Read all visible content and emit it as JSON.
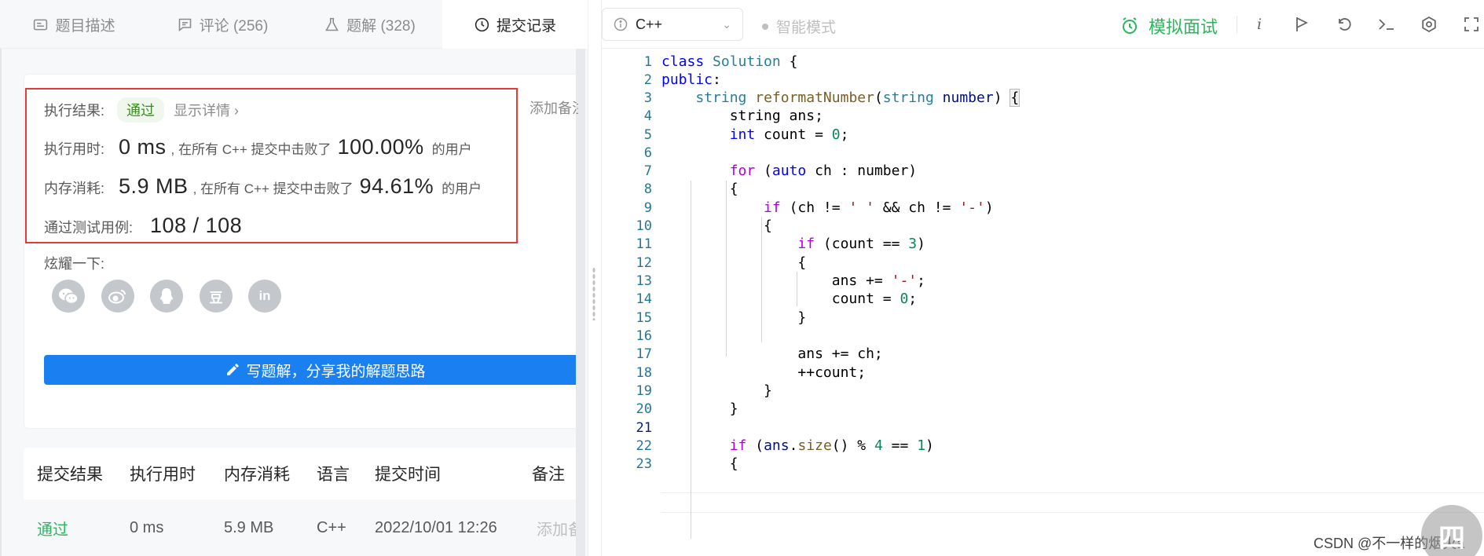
{
  "left_tabs": [
    {
      "label": "题目描述",
      "icon": "description-icon"
    },
    {
      "label": "评论 (256)",
      "icon": "comment-icon"
    },
    {
      "label": "题解 (328)",
      "icon": "flask-icon"
    },
    {
      "label": "提交记录",
      "icon": "clock-icon",
      "active": true
    }
  ],
  "result": {
    "status_label": "执行结果:",
    "status_value": "通过",
    "detail_link": "显示详情",
    "add_note": "添加备注",
    "time_label": "执行用时:",
    "time_value": "0 ms",
    "time_text": ", 在所有 C++ 提交中击败了",
    "time_percent": "100.00%",
    "mem_label": "内存消耗:",
    "mem_value": "5.9 MB",
    "mem_text": ", 在所有 C++ 提交中击败了",
    "mem_percent": "94.61%",
    "users_text": "的用户",
    "tests_label": "通过测试用例:",
    "tests_value": "108 / 108"
  },
  "share": {
    "label": "炫耀一下:",
    "icons": [
      "wechat-icon",
      "weibo-icon",
      "qq-icon",
      "douban-icon",
      "linkedin-icon"
    ],
    "douban_glyph": "豆",
    "linkedin_glyph": "in"
  },
  "write_solution_button": "写题解，分享我的解题思路",
  "submissions_table": {
    "headers": [
      "提交结果",
      "执行用时",
      "内存消耗",
      "语言",
      "提交时间",
      "备注"
    ],
    "rows": [
      {
        "status": "通过",
        "time": "0 ms",
        "memory": "5.9 MB",
        "language": "C++",
        "submitted_at": "2022/10/01 12:26",
        "note": "添加备注"
      }
    ]
  },
  "editor_toolbar": {
    "language": "C++",
    "smart_mode": "智能模式",
    "mock_interview": "模拟面试",
    "info_glyph": "i",
    "accent_color": "#2db55d"
  },
  "editor": {
    "line_numbers": [
      "1",
      "2",
      "3",
      "4",
      "5",
      "6",
      "7",
      "8",
      "9",
      "10",
      "11",
      "12",
      "13",
      "14",
      "15",
      "16",
      "17",
      "18",
      "19",
      "20",
      "21",
      "22",
      "23"
    ]
  },
  "watermark": "CSDN @不一样的烟火a",
  "float_button_glyph": "四"
}
